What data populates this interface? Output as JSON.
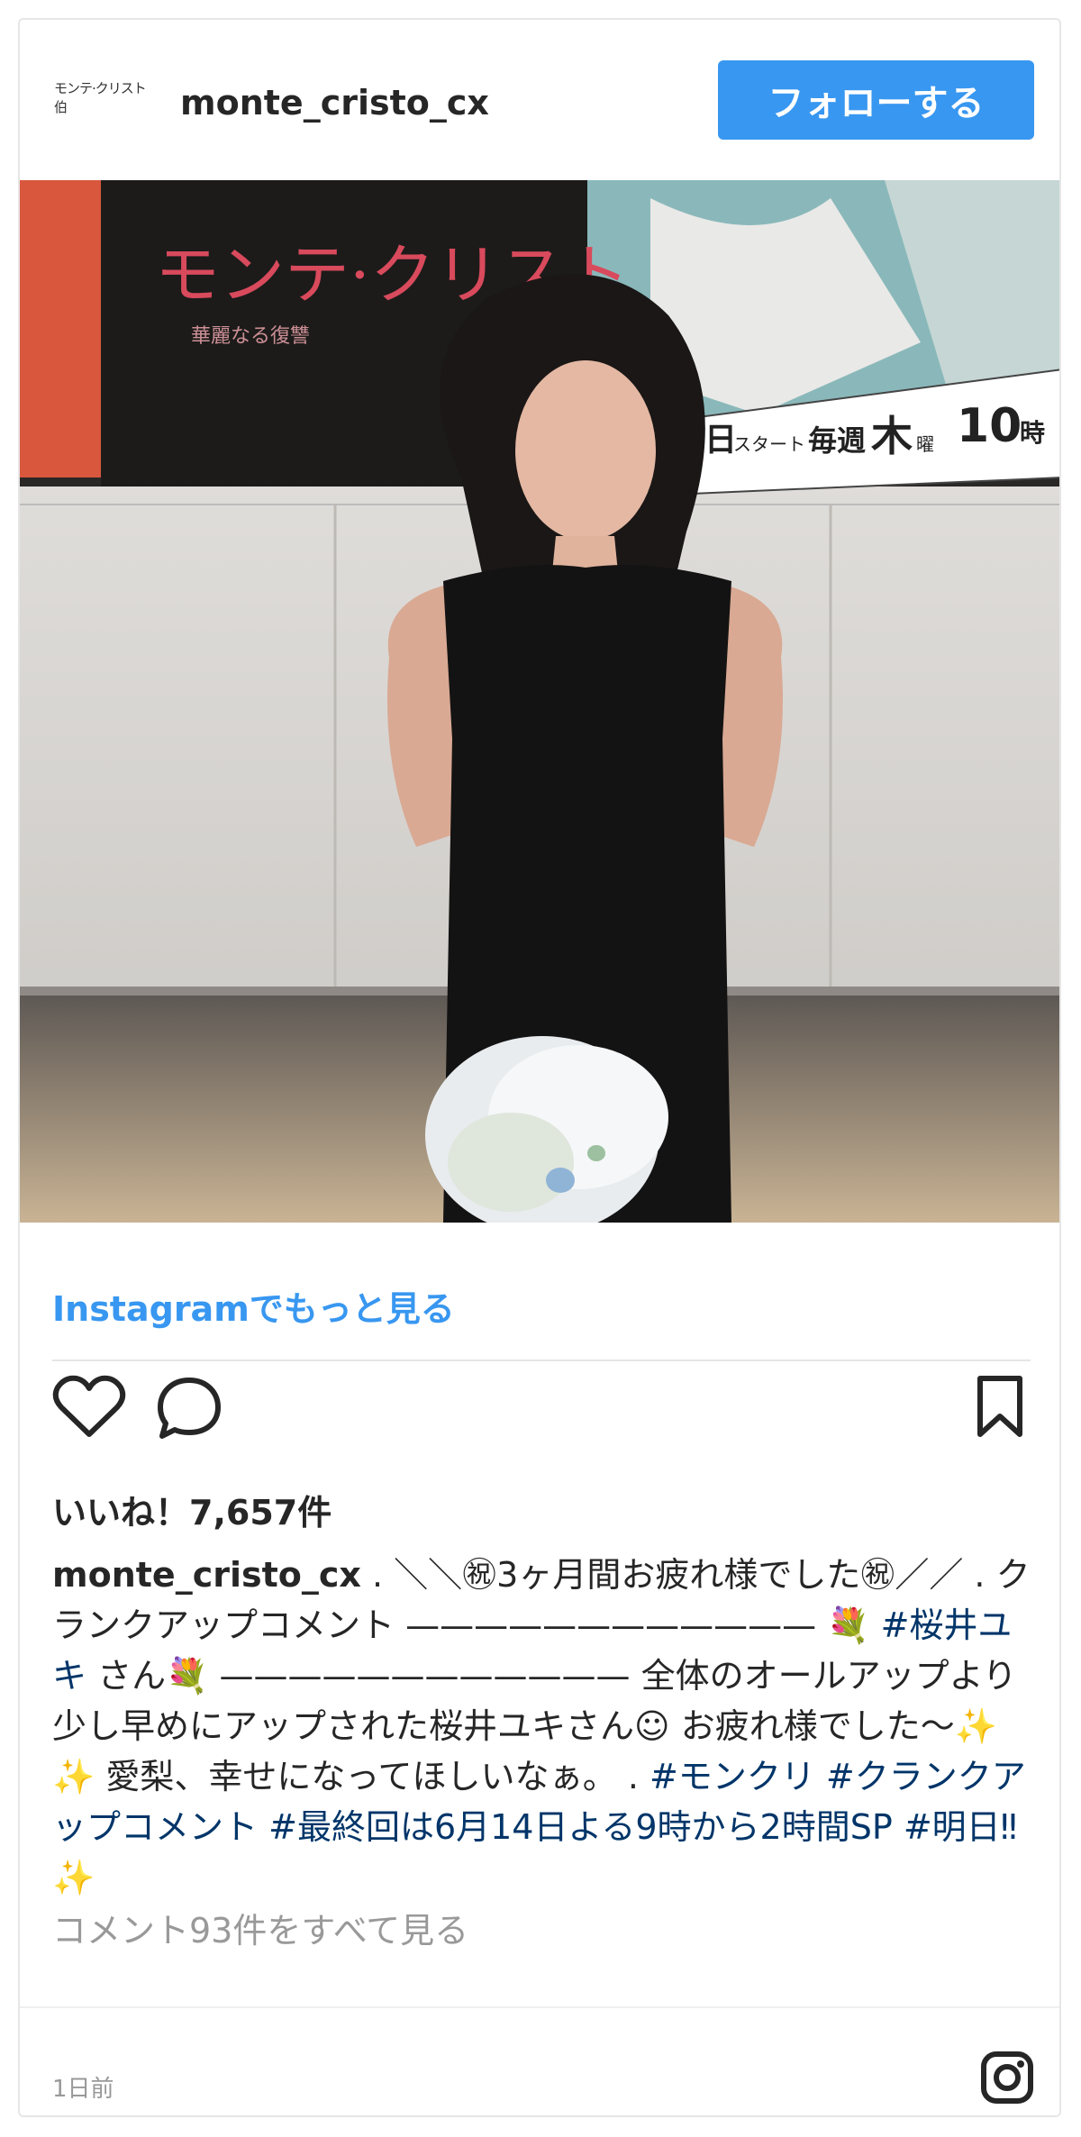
{
  "header": {
    "avatar_text": "モンテ·クリスト伯",
    "username": "monte_cristo_cx",
    "follow_label": "フォローする"
  },
  "media": {
    "poster_title": "モンテ·クリスト",
    "poster_subtitle": "華麗なる復讐",
    "poster_schedule_day": "9日",
    "poster_schedule_start": "スタート",
    "poster_schedule_weekly": "毎週",
    "poster_schedule_weekday": "木",
    "poster_schedule_yobi": "曜",
    "poster_schedule_time": "10",
    "poster_schedule_ji": "時"
  },
  "more_link": "Instagramでもっと見る",
  "actions": {
    "like_icon": "heart-icon",
    "comment_icon": "comment-icon",
    "save_icon": "bookmark-icon"
  },
  "likes": "いいね！7,657件",
  "caption": {
    "user": "monte_cristo_cx",
    "part1": " . ＼＼㊗3ヶ月間お疲れ様でした㊗／／ . クランクアップコメント ———————————— 💐 ",
    "tag1": "#桜井ユキ",
    "part2": " さん💐 ———————————— 全体のオールアップより少し早めにアップされた桜井ユキさん☺ お疲れ様でした〜✨✨ 愛梨、幸せになってほしいなぁ。 . ",
    "tag2": "#モンクリ",
    "tag3": "#クランクアップコメント",
    "tag4": "#最終回は6月14日よる9時から2時間SP",
    "tag5": "#明日‼",
    "part3": "✨"
  },
  "comments_link": "コメント93件をすべて見る",
  "timestamp": "1日前",
  "colors": {
    "follow_button": "#3897f0",
    "link": "#3897f0",
    "hashtag": "#003569",
    "muted": "#999999"
  }
}
